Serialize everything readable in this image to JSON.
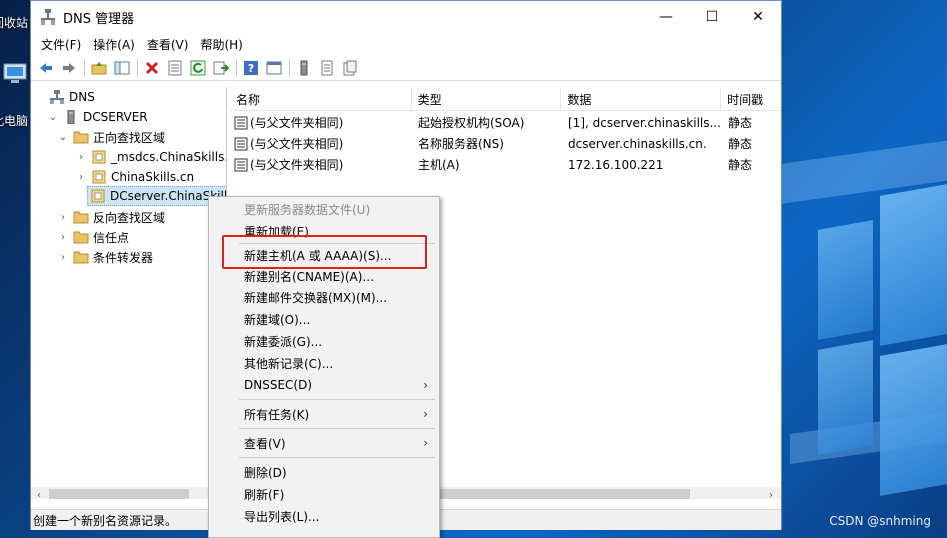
{
  "desktop": {
    "icons": [
      {
        "label": "回收站"
      },
      {
        "label": "此电脑"
      }
    ],
    "watermark": "CSDN @snhming"
  },
  "window": {
    "title": "DNS 管理器",
    "controls": {
      "minimize": "—",
      "maximize": "☐",
      "close": "✕"
    }
  },
  "menu": [
    "文件(F)",
    "操作(A)",
    "查看(V)",
    "帮助(H)"
  ],
  "tree": {
    "items": [
      {
        "label": "DNS",
        "icon": "dns-icon",
        "chevron": ""
      },
      {
        "label": "DCSERVER",
        "icon": "server-icon",
        "chevron": "⌄"
      },
      {
        "label": "正向查找区域",
        "icon": "folder-icon",
        "chevron": "⌄"
      },
      {
        "label": "_msdcs.ChinaSkills.c",
        "icon": "zone-icon",
        "chevron": "›"
      },
      {
        "label": "ChinaSkills.cn",
        "icon": "zone-icon",
        "chevron": "›"
      },
      {
        "label": "DCserver.ChinaSkill",
        "icon": "zone-icon",
        "chevron": ""
      },
      {
        "label": "反向查找区域",
        "icon": "folder-icon",
        "chevron": "›"
      },
      {
        "label": "信任点",
        "icon": "folder-icon",
        "chevron": "›"
      },
      {
        "label": "条件转发器",
        "icon": "folder-icon",
        "chevron": "›"
      }
    ]
  },
  "list": {
    "columns": [
      "名称",
      "类型",
      "数据",
      "时间戳"
    ],
    "rows": [
      {
        "name": "(与父文件夹相同)",
        "type": "起始授权机构(SOA)",
        "data": "[1], dcserver.chinaskills....",
        "timestamp": "静态"
      },
      {
        "name": "(与父文件夹相同)",
        "type": "名称服务器(NS)",
        "data": "dcserver.chinaskills.cn.",
        "timestamp": "静态"
      },
      {
        "name": "(与父文件夹相同)",
        "type": "主机(A)",
        "data": "172.16.100.221",
        "timestamp": "静态"
      }
    ]
  },
  "status": "创建一个新别名资源记录。",
  "context_menu": {
    "items": [
      {
        "label": "更新服务器数据文件(U)",
        "disabled": true,
        "submenu": false
      },
      {
        "label": "重新加载(E)",
        "disabled": false,
        "submenu": false
      },
      {
        "label": "新建主机(A 或 AAAA)(S)...",
        "disabled": false,
        "submenu": false
      },
      {
        "label": "新建别名(CNAME)(A)...",
        "disabled": false,
        "submenu": false
      },
      {
        "label": "新建邮件交换器(MX)(M)...",
        "disabled": false,
        "submenu": false
      },
      {
        "label": "新建域(O)...",
        "disabled": false,
        "submenu": false
      },
      {
        "label": "新建委派(G)...",
        "disabled": false,
        "submenu": false
      },
      {
        "label": "其他新记录(C)...",
        "disabled": false,
        "submenu": false
      },
      {
        "label": "DNSSEC(D)",
        "disabled": false,
        "submenu": true
      },
      {
        "label": "所有任务(K)",
        "disabled": false,
        "submenu": true
      },
      {
        "label": "查看(V)",
        "disabled": false,
        "submenu": true
      },
      {
        "label": "删除(D)",
        "disabled": false,
        "submenu": false
      },
      {
        "label": "刷新(F)",
        "disabled": false,
        "submenu": false
      },
      {
        "label": "导出列表(L)...",
        "disabled": false,
        "submenu": false
      }
    ],
    "submenu_arrow": "›",
    "highlight_color": "#e02020"
  }
}
